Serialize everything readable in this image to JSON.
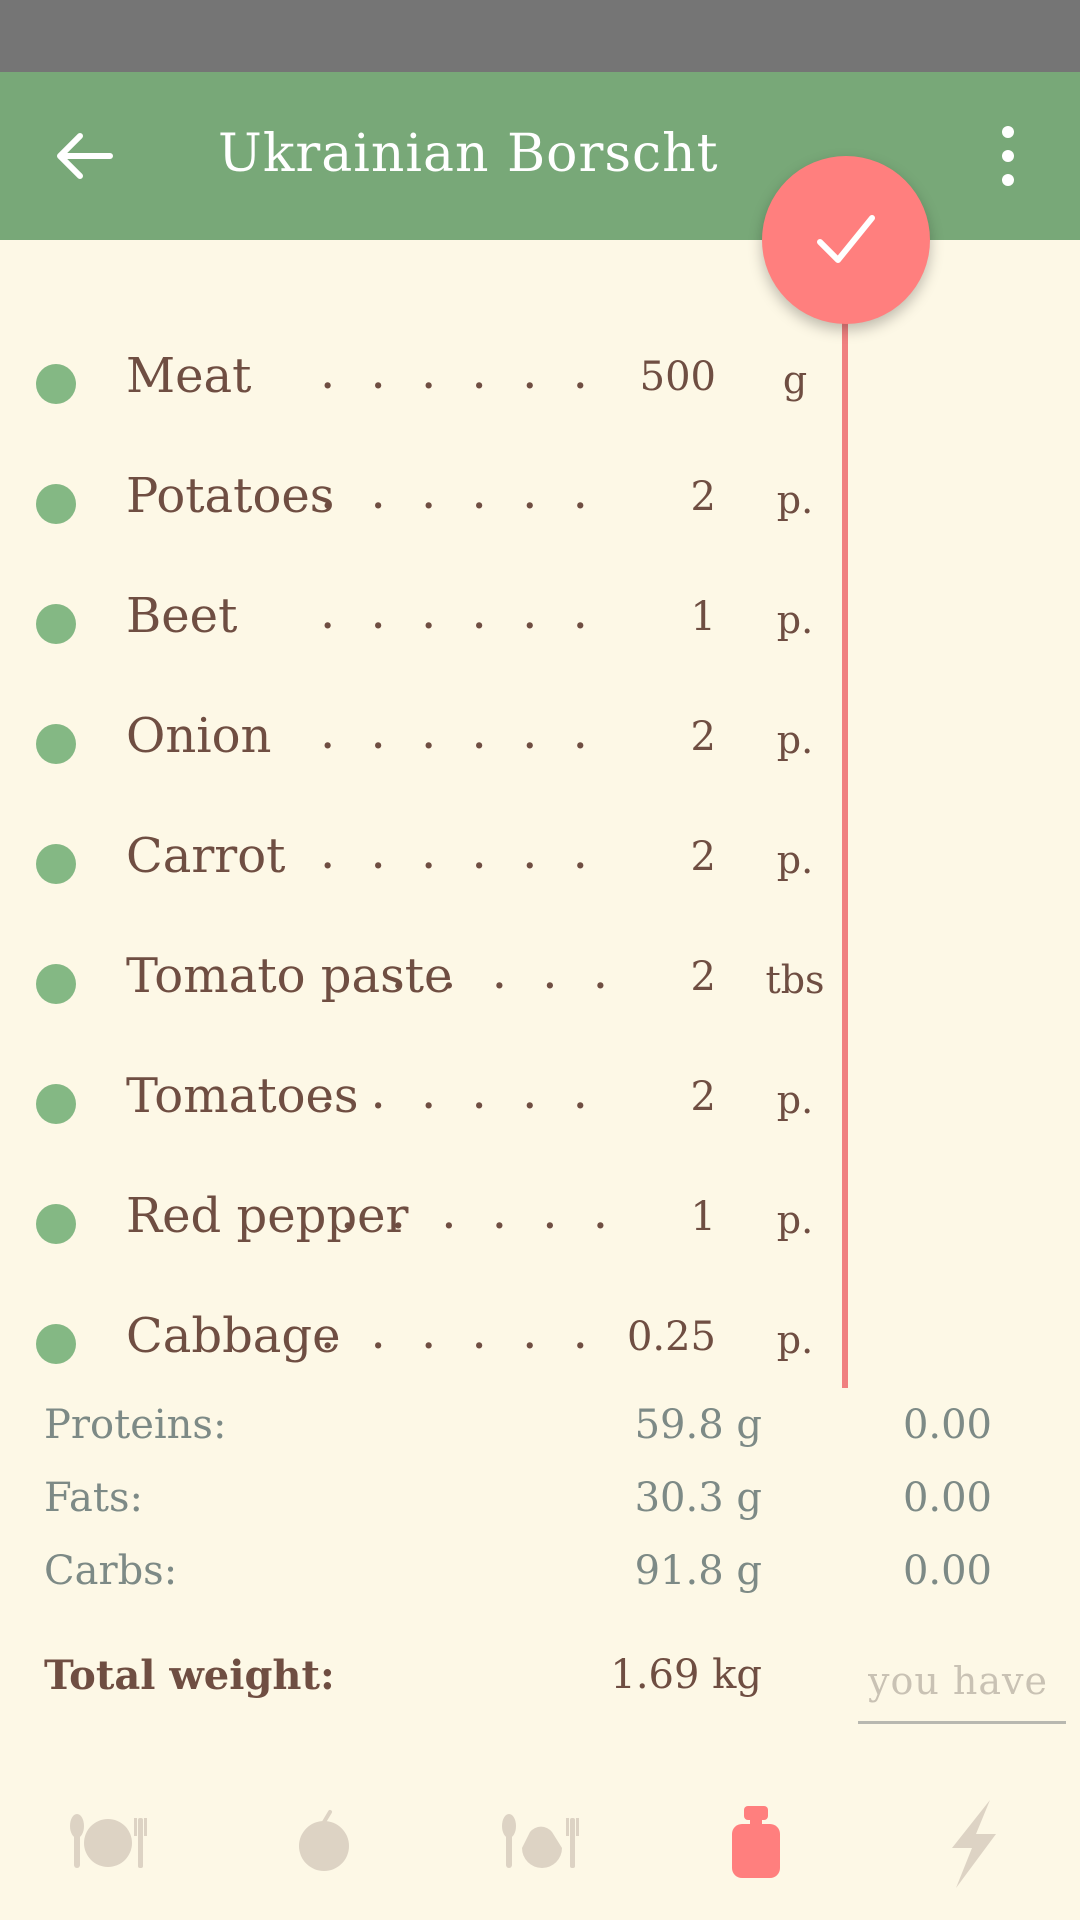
{
  "header": {
    "title": "Ukrainian Borscht",
    "back_icon": "arrow-left-icon",
    "menu_icon": "more-vert-icon"
  },
  "fab": {
    "icon": "check-icon",
    "color": "#ff7f7e"
  },
  "colors": {
    "app_bar": "#78a878",
    "status_bar": "#757575",
    "background": "#fdf8e6",
    "accent": "#f08080",
    "dot": "#84b884",
    "text": "#6f4e42",
    "muted": "#7d8a86"
  },
  "ingredients": [
    {
      "name": "Meat",
      "dots": ". . . . . . . . .",
      "qty": "500",
      "unit": "g"
    },
    {
      "name": "Potatoes",
      "dots": ". . . . . . . .",
      "qty": "2",
      "unit": "p."
    },
    {
      "name": "Beet",
      "dots": ". . . . . . . . .",
      "qty": "1",
      "unit": "p."
    },
    {
      "name": "Onion",
      "dots": ". . . . . . . . .",
      "qty": "2",
      "unit": "p."
    },
    {
      "name": "Carrot",
      "dots": ". . . . . . . . .",
      "qty": "2",
      "unit": "p."
    },
    {
      "name": "Tomato paste",
      "dots": ". . . . .",
      "qty": "2",
      "unit": "tbs"
    },
    {
      "name": "Tomatoes",
      "dots": ". . . . . . .",
      "qty": "2",
      "unit": "p."
    },
    {
      "name": "Red pepper",
      "dots": ". . . . . .",
      "qty": "1",
      "unit": "p."
    },
    {
      "name": "Cabbage",
      "dots": ". . . . . . . .",
      "qty": "0.25",
      "unit": "p."
    }
  ],
  "nutrition": [
    {
      "label": "Proteins:",
      "value": "59.8 g",
      "have": "0.00"
    },
    {
      "label": "Fats:",
      "value": "30.3 g",
      "have": "0.00"
    },
    {
      "label": "Carbs:",
      "value": "91.8 g",
      "have": "0.00"
    }
  ],
  "total": {
    "label": "Total weight:",
    "value": "1.69 kg",
    "input_placeholder": "you have"
  },
  "nav": [
    {
      "icon": "plate-cutlery-icon",
      "active": false
    },
    {
      "icon": "apple-icon",
      "active": false
    },
    {
      "icon": "chicken-leg-icon",
      "active": false
    },
    {
      "icon": "weight-icon",
      "active": true
    },
    {
      "icon": "lightning-icon",
      "active": false
    }
  ]
}
